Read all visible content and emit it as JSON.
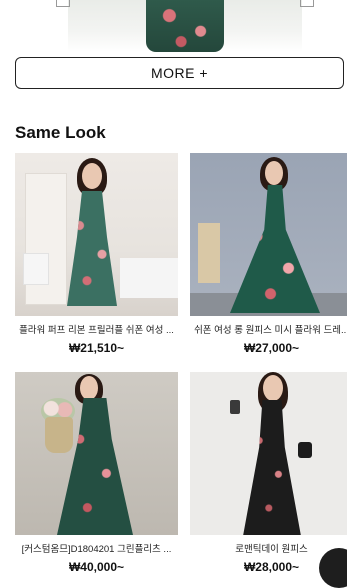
{
  "more_button": {
    "label": "MORE +"
  },
  "section": {
    "title": "Same Look"
  },
  "products": [
    {
      "name": "플라워 퍼프 리본 프릴러플 쉬폰 여성 ...",
      "price": "₩21,510~"
    },
    {
      "name": "쉬폰 여성 롱 원피스 미시 플라워 드레...",
      "price": "₩27,000~"
    },
    {
      "name": "[커스텀옴므]D1804201 그린플리츠 ...",
      "price": "₩40,000~"
    },
    {
      "name": "로맨틱데이 원피스",
      "price": "₩28,000~"
    }
  ],
  "colors": {
    "button_border": "#222222",
    "dress_green": "#2f5a4b",
    "dress_dark": "#1f1f1f"
  },
  "icons": [
    "floating-action-icon"
  ]
}
